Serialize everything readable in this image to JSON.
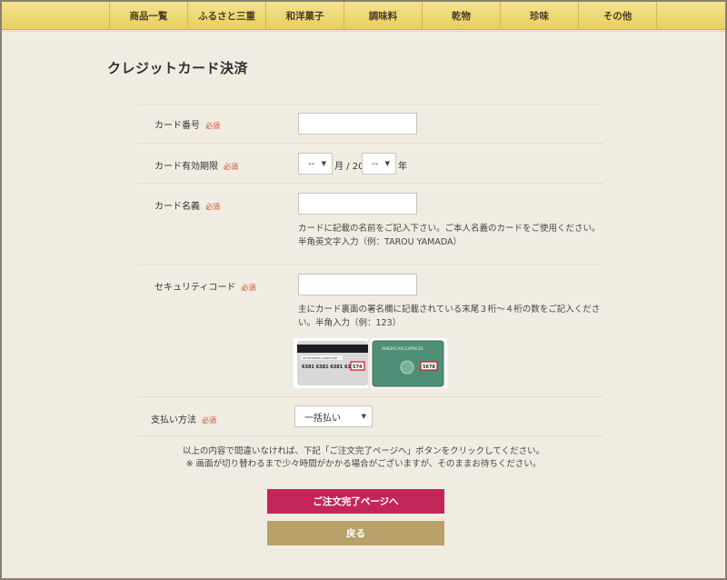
{
  "nav": {
    "items": [
      "商品一覧",
      "ふるさと三重",
      "和洋菓子",
      "調味料",
      "乾物",
      "珍味",
      "その他"
    ]
  },
  "page": {
    "title": "クレジットカード決済"
  },
  "form": {
    "required_mark": "必須",
    "card_number": {
      "label": "カード番号",
      "value": ""
    },
    "expiry": {
      "label": "カード有効期限",
      "month_value": "--",
      "month_suffix": "月 / 20",
      "year_value": "--",
      "year_suffix": "年"
    },
    "card_name": {
      "label": "カード名義",
      "value": "",
      "help": "カードに記載の名前をご記入下さい。ご本人名義のカードをご使用ください。半角英文字入力（例：TAROU YAMADA）"
    },
    "security_code": {
      "label": "セキュリティコード",
      "value": "",
      "help": "主にカード裏面の署名欄に記載されている末尾３桁～４桁の数をご記入ください。半角入力（例：123）",
      "card_back_number": "6381 6381 6381 6381",
      "card_back_code": "574",
      "card_back_strip_text": "AUTHORIZED SIGNATURE",
      "amex_brand": "AMERICAN EXPRESS",
      "amex_code": "5678"
    },
    "payment": {
      "label": "支払い方法",
      "value": "一括払い"
    }
  },
  "notice": {
    "line1": "以上の内容で間違いなければ、下記「ご注文完了ページへ」ボタンをクリックしてください。",
    "line2": "※ 画面が切り替わるまで少々時間がかかる場合がございますが、そのままお待ちください。"
  },
  "buttons": {
    "submit": "ご注文完了ページへ",
    "back": "戻る"
  },
  "colors": {
    "nav": "#e9d56c",
    "primary": "#c3275a",
    "back": "#b8a269",
    "required": "#d04a35"
  }
}
